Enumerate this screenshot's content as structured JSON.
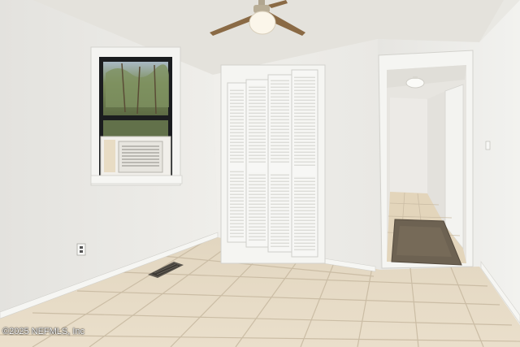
{
  "watermark": {
    "text": "©2025 NEFMLS, Inc"
  },
  "colors": {
    "wall": "#ecebe7",
    "ceiling": "#e4e2dc",
    "floor_tile": "#e6d9c2",
    "grout": "#cdbfa8",
    "trim": "#f5f5f2",
    "window_frame": "#1b1d1f",
    "trees": "#6b7f4a"
  },
  "scene": {
    "objects": [
      {
        "name": "ceiling-fan"
      },
      {
        "name": "window-with-ac-unit"
      },
      {
        "name": "bifold-louvered-closet-door"
      },
      {
        "name": "hallway-doorway"
      },
      {
        "name": "hallway-light"
      },
      {
        "name": "floor-vent"
      },
      {
        "name": "hallway-rug"
      },
      {
        "name": "electrical-outlet"
      }
    ]
  }
}
